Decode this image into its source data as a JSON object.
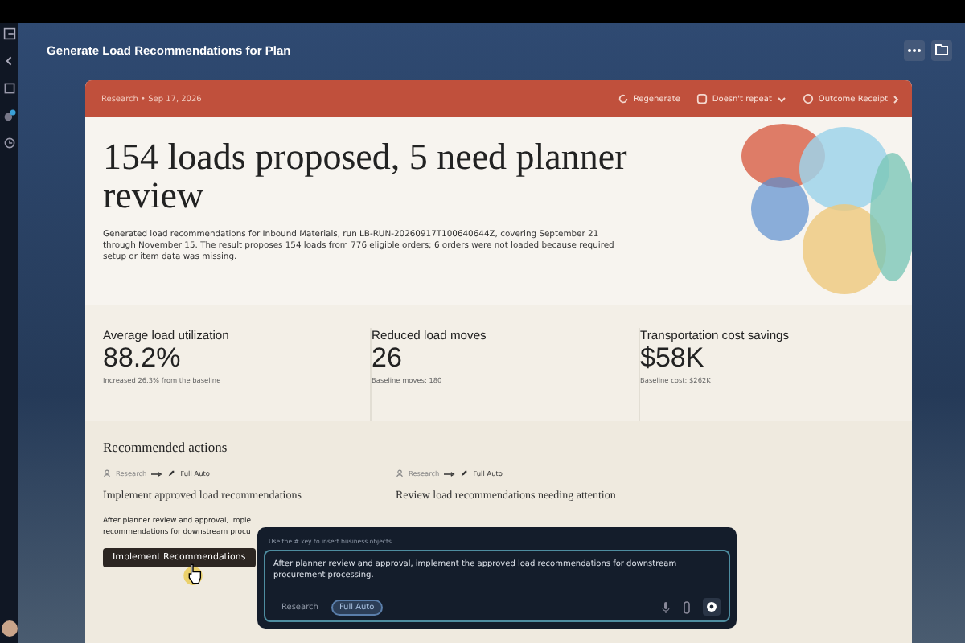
{
  "window": {
    "title": "Generate Load Recommendations for Plan"
  },
  "card_header": {
    "meta": "Research • Sep 17, 2026",
    "actions": [
      {
        "kind": "regenerate",
        "label": "Regenerate"
      },
      {
        "kind": "repeat",
        "label": "Doesn't repeat"
      },
      {
        "kind": "receipt",
        "label": "Outcome Receipt"
      }
    ]
  },
  "hero": {
    "title": "154 loads proposed, 5 need planner review",
    "description": "Generated load recommendations for Inbound Materials, run LB-RUN-20260917T100640644Z, covering September 21 through November 15. The result proposes 154 loads from 776 eligible orders; 6 orders were not loaded because required setup or item data was missing."
  },
  "metrics": [
    {
      "label": "Average load utilization",
      "value": "88.2%",
      "note": "Increased 26.3% from the baseline"
    },
    {
      "label": "Reduced load moves",
      "value": "26",
      "note": "Baseline moves: 180"
    },
    {
      "label": "Transportation cost savings",
      "value": "$58K",
      "note": "Baseline cost: $262K"
    }
  ],
  "recommended": {
    "title": "Recommended actions",
    "actions": [
      {
        "from": "Research",
        "to": "Full Auto",
        "title": "Implement approved load recommendations",
        "description_lines": [
          "After planner review and approval, imple",
          "recommendations for downstream procu"
        ],
        "button": "Implement Recommendations"
      },
      {
        "from": "Research",
        "to": "Full Auto",
        "title": "Review load recommendations needing attention"
      }
    ]
  },
  "composer": {
    "hint": "Use the # key to insert business objects.",
    "value": "After planner review and approval, implement the approved load recommendations for downstream procurement processing.",
    "modes": [
      {
        "label": "Research",
        "selected": false
      },
      {
        "label": "Full Auto",
        "selected": true
      }
    ]
  }
}
